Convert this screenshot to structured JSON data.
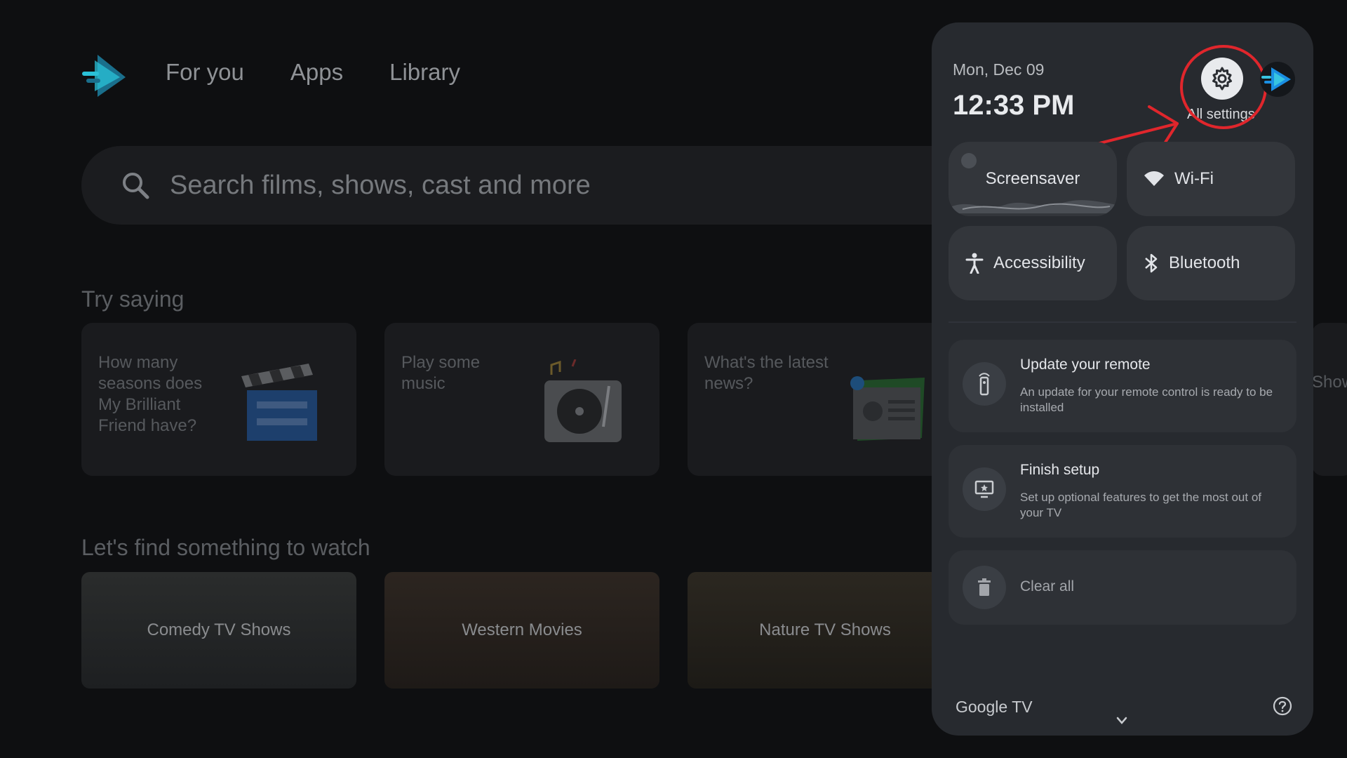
{
  "nav": {
    "items": [
      "For you",
      "Apps",
      "Library"
    ]
  },
  "search": {
    "placeholder": "Search films, shows, cast and more"
  },
  "try_saying": {
    "title": "Try saying",
    "tiles": [
      "How many seasons does My Brilliant Friend have?",
      "Play some music",
      "What's the latest news?",
      "Show free"
    ]
  },
  "find": {
    "title": "Let's find something to watch",
    "cards": [
      "Comedy TV Shows",
      "Western Movies",
      "Nature TV Shows"
    ]
  },
  "panel": {
    "date": "Mon, Dec 09",
    "time": "12:33 PM",
    "settings_label": "All settings",
    "toggles": {
      "screensaver": "Screensaver",
      "wifi": "Wi-Fi",
      "accessibility": "Accessibility",
      "bluetooth": "Bluetooth"
    },
    "notifications": [
      {
        "title": "Update your remote",
        "desc": "An update for your remote control is ready to be installed"
      },
      {
        "title": "Finish setup",
        "desc": "Set up optional features to get the most out of your TV"
      }
    ],
    "clear_all": "Clear all",
    "brand": "Google TV"
  },
  "colors": {
    "accent_blue": "#1a8fe3",
    "highlight_red": "#e0262c",
    "panel_bg": "#272a2f"
  }
}
